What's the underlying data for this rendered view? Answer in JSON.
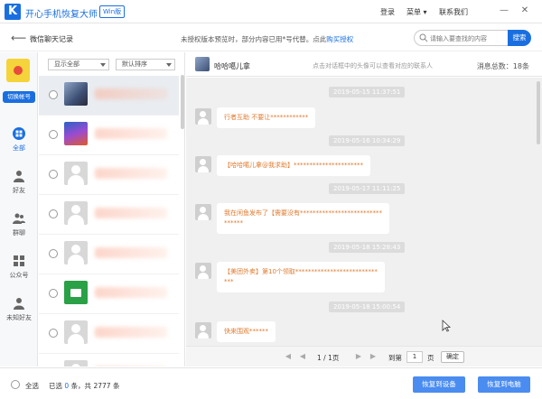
{
  "app": {
    "name": "开心手机恢复大师",
    "edition": "Win版",
    "logo_letter": "K",
    "menu": {
      "login": "登录",
      "menu": "菜单",
      "contact": "联系我们"
    }
  },
  "toolbar": {
    "breadcrumb": "微信聊天记录",
    "notice": "未授权版本预览时，部分内容已用*号代替。点此",
    "buy_link": "购买授权",
    "search_placeholder": "请输入要查找的内容",
    "search_button": "搜索"
  },
  "sidebar": {
    "switch_account": "切换帐号",
    "items": [
      {
        "label": "全部",
        "icon": "grid-icon",
        "active": true
      },
      {
        "label": "好友",
        "icon": "person-icon",
        "active": false
      },
      {
        "label": "群聊",
        "icon": "group-icon",
        "active": false
      },
      {
        "label": "公众号",
        "icon": "official-account-icon",
        "active": false
      },
      {
        "label": "未知好友",
        "icon": "unknown-person-icon",
        "active": false
      }
    ]
  },
  "contacts": {
    "filter_show": "显示全部",
    "filter_sort": "默认排序"
  },
  "chat": {
    "contact_name": "哈哈噶儿拿",
    "tip": "点击对话框中的头像可以查看对应的联系人",
    "total": "消息总数：18条",
    "messages": [
      {
        "time": "2019-05-15 11:37:51",
        "text": "行者互助 不要让************"
      },
      {
        "time": "2019-05-16 10:34:29",
        "text": "【哈哈噶儿拿@我求助】**********************"
      },
      {
        "time": "2019-05-17 11:11:25",
        "text": "我在闲鱼发布了【需要没有**************************",
        "text2": "******"
      },
      {
        "time": "2019-05-18 15:28:43",
        "text": "【美团外卖】第10个领取**************************",
        "text2": "***"
      },
      {
        "time": "2019-05-18 15:00:54",
        "text": "快来围观******"
      }
    ]
  },
  "pager": {
    "page_info": "1 / 1页",
    "goto_label": "到第",
    "page_value": "1",
    "page_unit": "页",
    "confirm": "确定"
  },
  "footer": {
    "select_all": "全选",
    "selected_prefix": "已选",
    "selected_count": "0",
    "selected_mid": "条，共",
    "total_count": "2777",
    "selected_suffix": "条",
    "restore_device": "恢复到设备",
    "restore_pc": "恢复到电脑"
  }
}
